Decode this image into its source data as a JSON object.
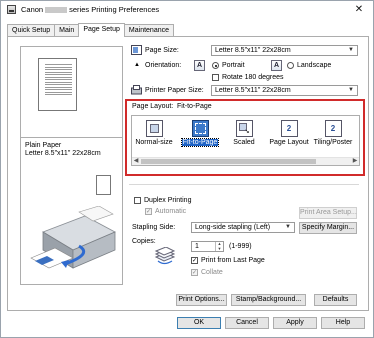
{
  "window": {
    "title_prefix": "Canon",
    "title_suffix": "series Printing Preferences",
    "close_symbol": "✕"
  },
  "tabs": [
    {
      "label": "Quick Setup",
      "active": false
    },
    {
      "label": "Main",
      "active": false
    },
    {
      "label": "Page Setup",
      "active": true
    },
    {
      "label": "Maintenance",
      "active": false
    }
  ],
  "preview": {
    "media_line1": "Plain Paper",
    "media_line2": "Letter 8.5\"x11\" 22x28cm"
  },
  "page_size": {
    "label": "Page Size:",
    "value": "Letter 8.5\"x11\" 22x28cm"
  },
  "orientation": {
    "label": "Orientation:",
    "portrait_label": "Portrait",
    "landscape_label": "Landscape",
    "selected": "Portrait",
    "portrait_icon_glyph": "A",
    "landscape_icon_glyph": "A"
  },
  "rotate": {
    "label": "Rotate 180 degrees",
    "checked": false
  },
  "printer_paper_size": {
    "label": "Printer Paper Size:",
    "value": "Letter 8.5\"x11\" 22x28cm"
  },
  "page_layout": {
    "label": "Page Layout:",
    "current": "Fit-to-Page",
    "items": [
      {
        "label": "Normal-size",
        "icon": "normal-size-icon",
        "selected": false
      },
      {
        "label": "Fit-to-Page",
        "icon": "fit-to-page-icon",
        "selected": true
      },
      {
        "label": "Scaled",
        "icon": "scaled-icon",
        "selected": false
      },
      {
        "label": "Page Layout",
        "icon": "page-layout-icon",
        "selected": false,
        "glyph": "2"
      },
      {
        "label": "Tiling/Poster",
        "icon": "tiling-poster-icon",
        "selected": false,
        "glyph": "2"
      }
    ]
  },
  "duplex": {
    "label": "Duplex Printing",
    "checked": false,
    "automatic_label": "Automatic",
    "automatic_check_glyph": "✓",
    "print_area_setup_label": "Print Area Setup..."
  },
  "stapling": {
    "label": "Stapling Side:",
    "value": "Long-side stapling (Left)",
    "specify_margin_label": "Specify Margin..."
  },
  "copies": {
    "label": "Copies:",
    "value": "1",
    "range": "(1-999)",
    "print_from_last_label": "Print from Last Page",
    "print_from_last_checked": true,
    "collate_label": "Collate",
    "collate_checked": true,
    "check_glyph": "✓"
  },
  "buttons": {
    "print_options": "Print Options...",
    "stamp_background": "Stamp/Background...",
    "defaults": "Defaults",
    "ok": "OK",
    "cancel": "Cancel",
    "apply": "Apply",
    "help": "Help"
  },
  "colors": {
    "highlight_border": "#d12b2b",
    "selection_blue": "#1e63c6"
  }
}
